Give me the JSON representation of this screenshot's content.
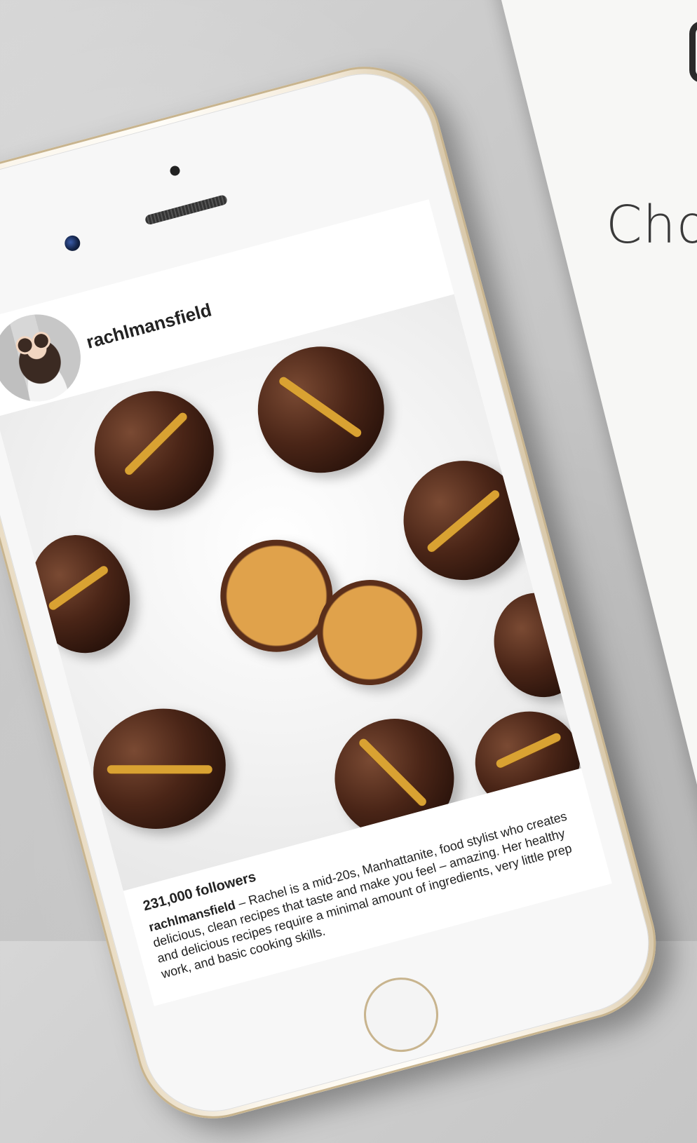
{
  "background": {
    "surface": "concrete",
    "paper_title": "Cho"
  },
  "post": {
    "username": "rachlmansfield",
    "followers": "231,000 followers",
    "bio_username": "rachlmansfield",
    "bio_text": " – Rachel is a mid-20s, Manhattanite, food stylist who creates delicious, clean recipes that taste and make you feel – amazing. Her healthy and delicious recipes require a minimal amount of ingredients, very little prep work, and basic cooking skills."
  },
  "colors": {
    "phone_gold": "#e9dcc4",
    "chocolate": "#4a2517",
    "peanut_butter": "#d9a232"
  }
}
